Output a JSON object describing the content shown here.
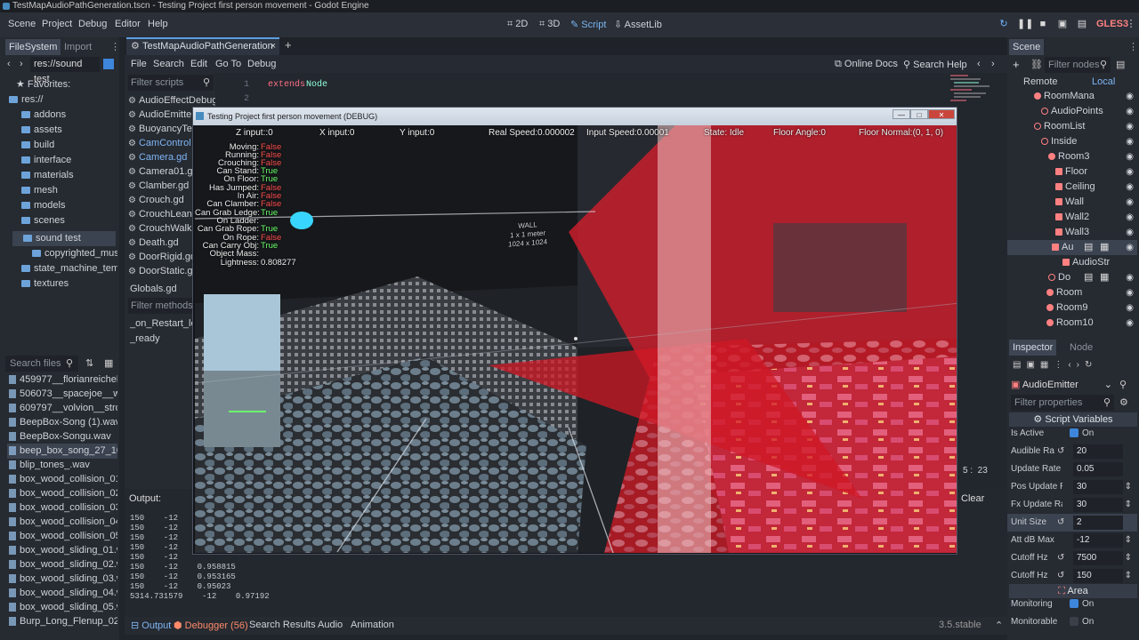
{
  "window_title": "TestMapAudioPathGeneration.tscn - Testing Project first person movement - Godot Engine",
  "menus": [
    "Scene",
    "Project",
    "Debug",
    "Editor",
    "Help"
  ],
  "workspaces": [
    {
      "label": "2D",
      "icon": "2d-icon"
    },
    {
      "label": "3D",
      "icon": "3d-icon"
    },
    {
      "label": "Script",
      "icon": "script-icon",
      "active": true
    },
    {
      "label": "AssetLib",
      "icon": "assetlib-icon"
    }
  ],
  "renderer": "GLES3",
  "filesystem": {
    "tabs": [
      "FileSystem",
      "Import"
    ],
    "path": "res://sound test",
    "favorites_label": "Favorites:",
    "tree": [
      "res://",
      "addons",
      "assets",
      "build",
      "interface",
      "materials",
      "mesh",
      "models",
      "scenes",
      "sound test",
      "copyrighted_musi",
      "state_machine_tem",
      "textures"
    ],
    "search_placeholder": "Search files",
    "files": [
      "459977__florianreichelt_",
      "506073__spacejoe__wate",
      "609797__volvion__strong",
      "BeepBox-Song (1).wav",
      "BeepBox-Songu.wav",
      "beep_box_song_27_10_2",
      "blip_tones_.wav",
      "box_wood_collision_01.w",
      "box_wood_collision_02.w",
      "box_wood_collision_03.w",
      "box_wood_collision_04.w",
      "box_wood_collision_05.w",
      "box_wood_sliding_01.wa",
      "box_wood_sliding_02.wa",
      "box_wood_sliding_03.wa",
      "box_wood_sliding_04.wa",
      "box_wood_sliding_05.wa",
      "Burp_Long_Flenup_022.w"
    ]
  },
  "script_editor": {
    "tab": "TestMapAudioPathGeneration",
    "menu": [
      "File",
      "Search",
      "Edit",
      "Go To",
      "Debug"
    ],
    "online_docs": "Online Docs",
    "search_help": "Search Help",
    "filter_scripts": "Filter scripts",
    "scripts": [
      "AudioEffectDebug",
      "AudioEmitter",
      "BuoyancyTe",
      "CamControl",
      "Camera.gd",
      "Camera01.gd",
      "Clamber.gd",
      "Crouch.gd",
      "CrouchLean",
      "CrouchWalk",
      "Death.gd",
      "DoorRigid.gd",
      "DoorStatic.gd"
    ],
    "globals": "Globals.gd",
    "filter_methods": "Filter methods",
    "methods": [
      "_on_Restart_lev",
      "_ready"
    ],
    "code": [
      {
        "n": "1",
        "kw": "extends",
        "ty": "Node"
      },
      {
        "n": "2",
        "kw": "",
        "ty": ""
      }
    ],
    "cursor": "5 :  23",
    "clear": "Clear"
  },
  "output": {
    "label": "Output:",
    "lines": [
      "150    -12",
      "150    -12",
      "150    -12",
      "150    -12",
      "150    -12",
      "150    -12    0.958815",
      "150    -12    0.953165",
      "150    -12    0.95023",
      "5314.731579    -12    0.97192"
    ]
  },
  "bottom_tabs": [
    "Output",
    "Debugger (56)",
    "Search Results",
    "Audio",
    "Animation"
  ],
  "version": "3.5.stable",
  "scene": {
    "tab": "Scene",
    "filter": "Filter nodes",
    "remote": "Remote",
    "local": "Local",
    "nodes": [
      {
        "label": "RoomMana",
        "color": "#ff8080"
      },
      {
        "label": "AudioPoints",
        "color": "#ff8080"
      },
      {
        "label": "RoomList",
        "color": "#ff8080"
      },
      {
        "label": "Inside",
        "color": "#ff8080"
      },
      {
        "label": "Room3",
        "color": "#ff8080"
      },
      {
        "label": "Floor",
        "color": "#ff8080"
      },
      {
        "label": "Ceiling",
        "color": "#ff8080"
      },
      {
        "label": "Wall",
        "color": "#ff8080"
      },
      {
        "label": "Wall2",
        "color": "#ff8080"
      },
      {
        "label": "Wall3",
        "color": "#ff8080"
      },
      {
        "label": "Au",
        "color": "#ff8080"
      },
      {
        "label": "AudioStr",
        "color": "#ff8080"
      },
      {
        "label": "Do",
        "color": "#ff8080"
      },
      {
        "label": "Room",
        "color": "#ff8080"
      },
      {
        "label": "Room9",
        "color": "#ff8080"
      },
      {
        "label": "Room10",
        "color": "#ff8080"
      }
    ]
  },
  "inspector": {
    "tabs": [
      "Inspector",
      "Node"
    ],
    "object": "AudioEmitter",
    "filter": "Filter properties",
    "section": "Script Variables",
    "area_section": "Area",
    "props": [
      {
        "label": "Is Active",
        "value": "On",
        "type": "check"
      },
      {
        "label": "Audible Ra",
        "value": "20",
        "type": "num"
      },
      {
        "label": "Update Rate",
        "value": "0.05",
        "type": "num"
      },
      {
        "label": "Pos Update R",
        "value": "30",
        "type": "num"
      },
      {
        "label": "Fx Update Ra",
        "value": "30",
        "type": "num"
      },
      {
        "label": "Unit Size",
        "value": "2",
        "type": "num"
      },
      {
        "label": "Att dB Max",
        "value": "-12",
        "type": "num"
      },
      {
        "label": "Cutoff Hz",
        "value": "7500",
        "type": "num"
      },
      {
        "label": "Cutoff Hz",
        "value": "150",
        "type": "num"
      }
    ],
    "area_props": [
      {
        "label": "Monitoring",
        "value": "On",
        "on": true
      },
      {
        "label": "Monitorable",
        "value": "On",
        "on": false
      }
    ]
  },
  "game": {
    "title": "Testing Project first person movement (DEBUG)",
    "top_stats": [
      "Z input::0",
      "X input:0",
      "Y input:0",
      "Real Speed:0.000002",
      "Input Speed:0.00001",
      "State: Idle",
      "Floor Angle:0",
      "Floor Normal:(0, 1, 0)"
    ],
    "debug": [
      {
        "label": "Moving:",
        "value": "False",
        "c": "f"
      },
      {
        "label": "Running:",
        "value": "False",
        "c": "f"
      },
      {
        "label": "Crouching:",
        "value": "False",
        "c": "f"
      },
      {
        "label": "Can Stand:",
        "value": "True",
        "c": "t"
      },
      {
        "label": "On Floor:",
        "value": "True",
        "c": "t"
      },
      {
        "label": "Has Jumped:",
        "value": "False",
        "c": "f"
      },
      {
        "label": "In Air:",
        "value": "False",
        "c": "f"
      },
      {
        "label": "Can Clamber:",
        "value": "False",
        "c": "f"
      },
      {
        "label": "Can Grab Ledge:",
        "value": "True",
        "c": "t"
      },
      {
        "label": "On Ladder:",
        "value": "",
        "c": "f"
      },
      {
        "label": "Can Grab Rope:",
        "value": "True",
        "c": "t"
      },
      {
        "label": "On Rope:",
        "value": "False",
        "c": "f"
      },
      {
        "label": "Can Carry Obj:",
        "value": "True",
        "c": "t"
      },
      {
        "label": "Object Mass:",
        "value": "",
        "c": "w"
      },
      {
        "label": "Lightness:",
        "value": "0.808277",
        "c": "w"
      }
    ],
    "wall_sign": [
      "WALL",
      "1 x 1 meter",
      "1024 x 1024"
    ]
  }
}
